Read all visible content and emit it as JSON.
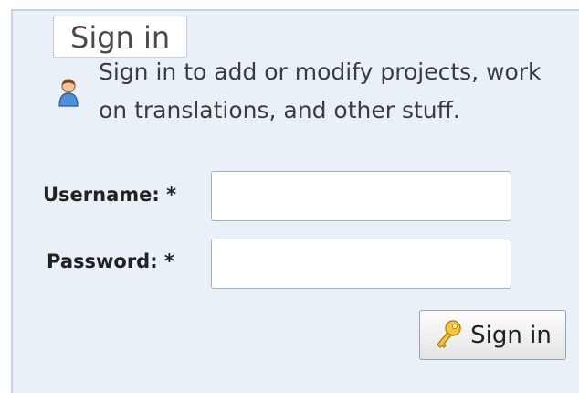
{
  "form": {
    "legend": "Sign in",
    "intro": "Sign in to add or modify projects, work on translations, and other stuff.",
    "username": {
      "label": "Username: *",
      "value": ""
    },
    "password": {
      "label": "Password: *",
      "value": ""
    },
    "submit_label": "Sign in"
  },
  "icons": {
    "user": "user-icon",
    "key": "key-icon"
  },
  "colors": {
    "panel_background": "#eaf0f7",
    "panel_border": "#c9d4e2"
  }
}
